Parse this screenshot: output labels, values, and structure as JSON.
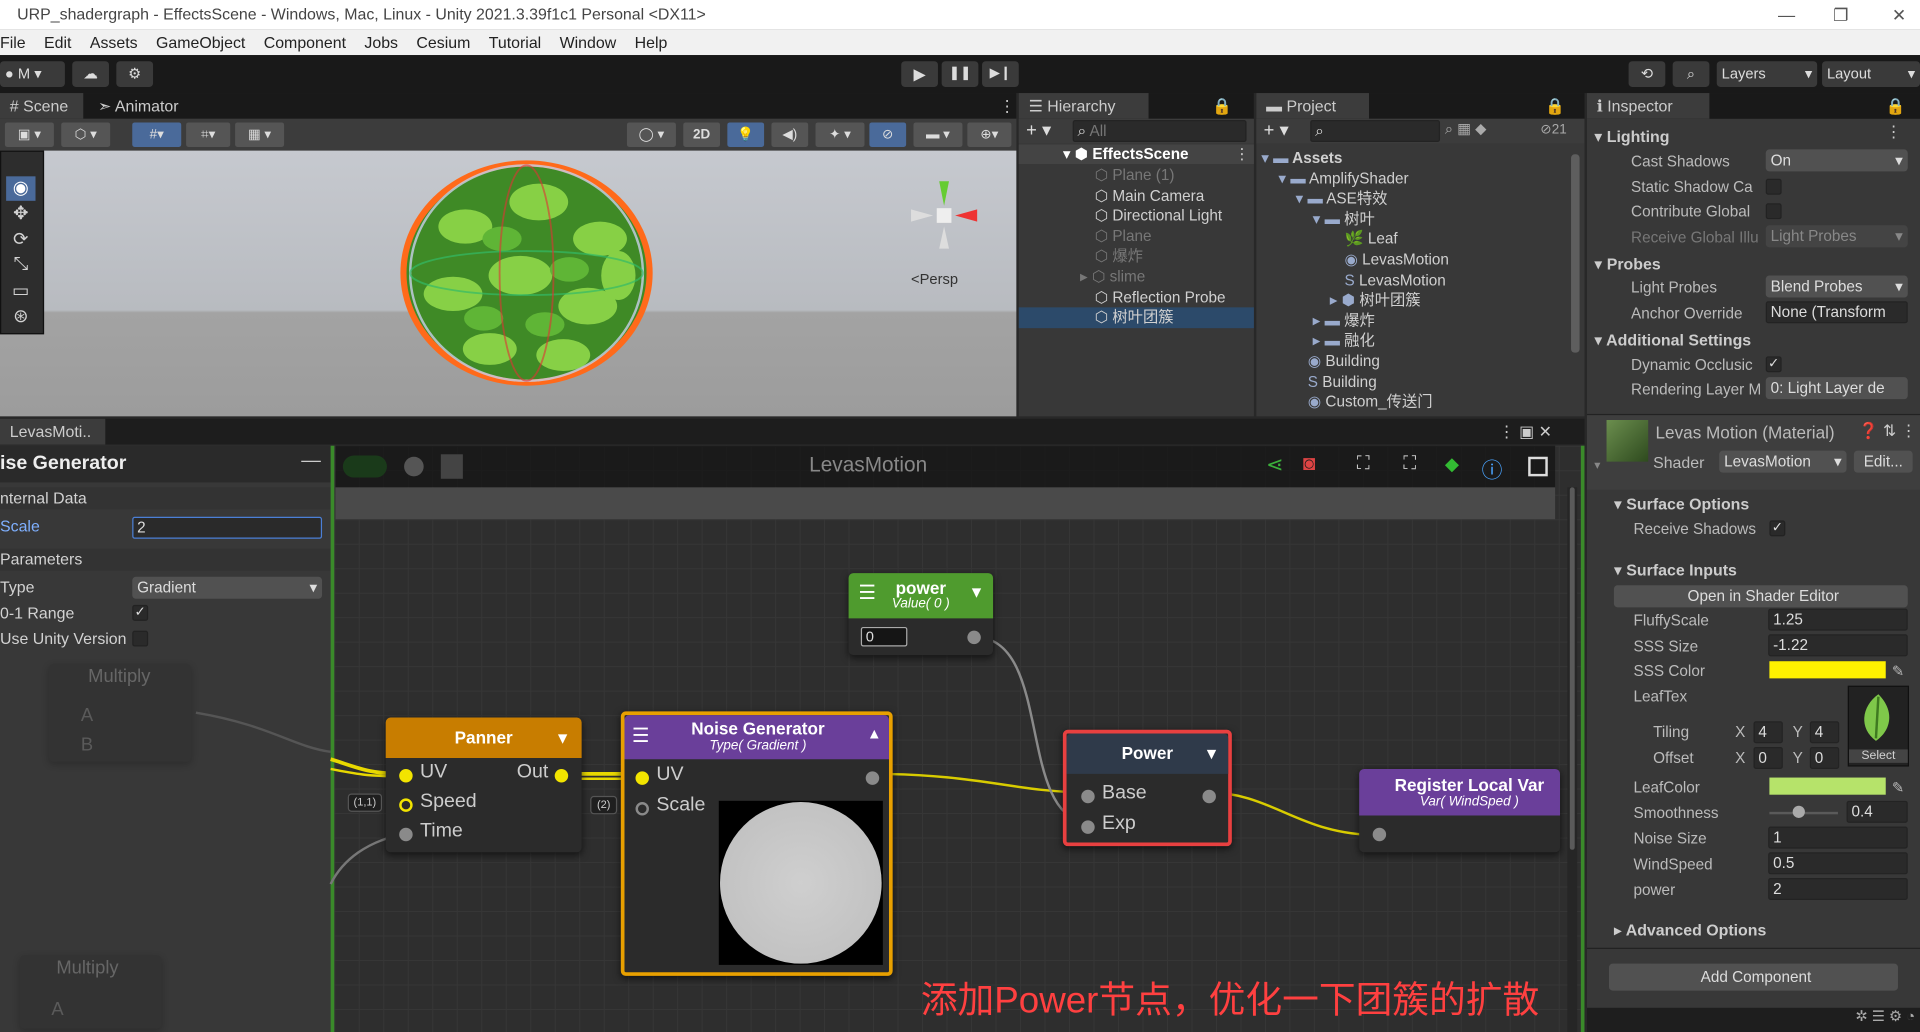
{
  "window": {
    "title": "URP_shadergraph - EffectsScene - Windows, Mac, Linux - Unity 2021.3.39f1c1 Personal <DX11>",
    "min": "—",
    "max": "❐",
    "close": "✕"
  },
  "menu": [
    "File",
    "Edit",
    "Assets",
    "GameObject",
    "Component",
    "Jobs",
    "Cesium",
    "Tutorial",
    "Window",
    "Help"
  ],
  "toolbar": {
    "account": "M",
    "layers": "Layers",
    "layout": "Layout"
  },
  "scene": {
    "tabs": [
      "Scene",
      "Animator"
    ],
    "btn2d": "2D",
    "persp": "<Persp"
  },
  "hierarchy": {
    "title": "Hierarchy",
    "search_placeholder": "All",
    "root": "EffectsScene",
    "items": [
      {
        "label": "Plane (1)",
        "dim": true
      },
      {
        "label": "Main Camera",
        "dim": false
      },
      {
        "label": "Directional Light",
        "dim": false
      },
      {
        "label": "Plane",
        "dim": true
      },
      {
        "label": "爆炸",
        "dim": true
      },
      {
        "label": "slime",
        "dim": true
      },
      {
        "label": "Reflection Probe",
        "dim": false
      },
      {
        "label": "树叶团簇",
        "dim": false
      }
    ]
  },
  "project": {
    "title": "Project",
    "badge": "21",
    "items": [
      "Assets",
      "AmplifyShader",
      "ASE特效",
      "树叶",
      "Leaf",
      "LevasMotion",
      "LevasMotion",
      "树叶团簇",
      "爆炸",
      "融化",
      "Building",
      "Building",
      "Custom_传送门"
    ]
  },
  "inspector": {
    "title": "Inspector",
    "lighting": {
      "header": "Lighting",
      "cast_shadows": "Cast Shadows",
      "cast_shadows_value": "On",
      "static_shadow": "Static Shadow Ca",
      "contribute_global": "Contribute Global",
      "receive_global": "Receive Global Illu",
      "receive_global_value": "Light Probes"
    },
    "probes": {
      "header": "Probes",
      "light_probes": "Light Probes",
      "light_probes_value": "Blend Probes",
      "anchor": "Anchor Override",
      "anchor_value": "None (Transform"
    },
    "additional": {
      "header": "Additional Settings",
      "dynamic": "Dynamic Occlusic",
      "rendering_layer": "Rendering Layer M",
      "rendering_layer_value": "0: Light Layer de"
    },
    "material": {
      "name": "Levas Motion (Material)",
      "shader_label": "Shader",
      "shader_value": "LevasMotion",
      "edit": "Edit..."
    },
    "surface_options": {
      "header": "Surface Options",
      "receive_shadows": "Receive Shadows"
    },
    "surface_inputs": {
      "header": "Surface Inputs",
      "open_editor": "Open in Shader Editor",
      "fluffy_label": "FluffyScale",
      "fluffy": "1.25",
      "sss_size_label": "SSS Size",
      "sss_size": "-1.22",
      "sss_color_label": "SSS Color",
      "leaftex_label": "LeafTex",
      "tiling_label": "Tiling",
      "tiling_x": "4",
      "tiling_y": "4",
      "offset_label": "Offset",
      "offset_x": "0",
      "offset_y": "0",
      "x": "X",
      "y": "Y",
      "select": "Select",
      "leafcolor_label": "LeafColor",
      "smooth_label": "Smoothness",
      "smooth": "0.4",
      "noise_label": "Noise Size",
      "noise": "1",
      "wind_label": "WindSpeed",
      "wind": "0.5",
      "power_label": "power",
      "power": "2"
    },
    "advanced": "Advanced Options",
    "add_component": "Add Component",
    "colors": {
      "sss": "#fff200",
      "leaf": "#b6e36a"
    }
  },
  "ase": {
    "tab": "LevasMoti..",
    "title": "LevasMotion",
    "node_title": "ise Generator",
    "internal": "nternal Data",
    "scale_label": "Scale",
    "scale_value": "2",
    "parameters": "Parameters",
    "type_label": "Type",
    "type_value": "Gradient",
    "range_label": "0-1 Range",
    "unity_label": "Use Unity Version",
    "ghost": {
      "multiply": "Multiply",
      "a": "A",
      "b": "B"
    },
    "nodes": {
      "power_value": {
        "title": "power",
        "sub": "Value( 0 )",
        "value": "0"
      },
      "panner": {
        "title": "Panner",
        "uv": "UV",
        "speed": "Speed",
        "time": "Time",
        "out": "Out",
        "speed_tag": "(1,1)"
      },
      "noise": {
        "title": "Noise Generator",
        "sub": "Type( Gradient )",
        "uv": "UV",
        "scale": "Scale",
        "scale_tag": "(2)"
      },
      "power": {
        "title": "Power",
        "base": "Base",
        "exp": "Exp"
      },
      "register": {
        "title": "Register Local Var",
        "sub": "Var( WindSped )"
      }
    },
    "caption": "添加Power节点，优化一下团簇的扩散"
  }
}
